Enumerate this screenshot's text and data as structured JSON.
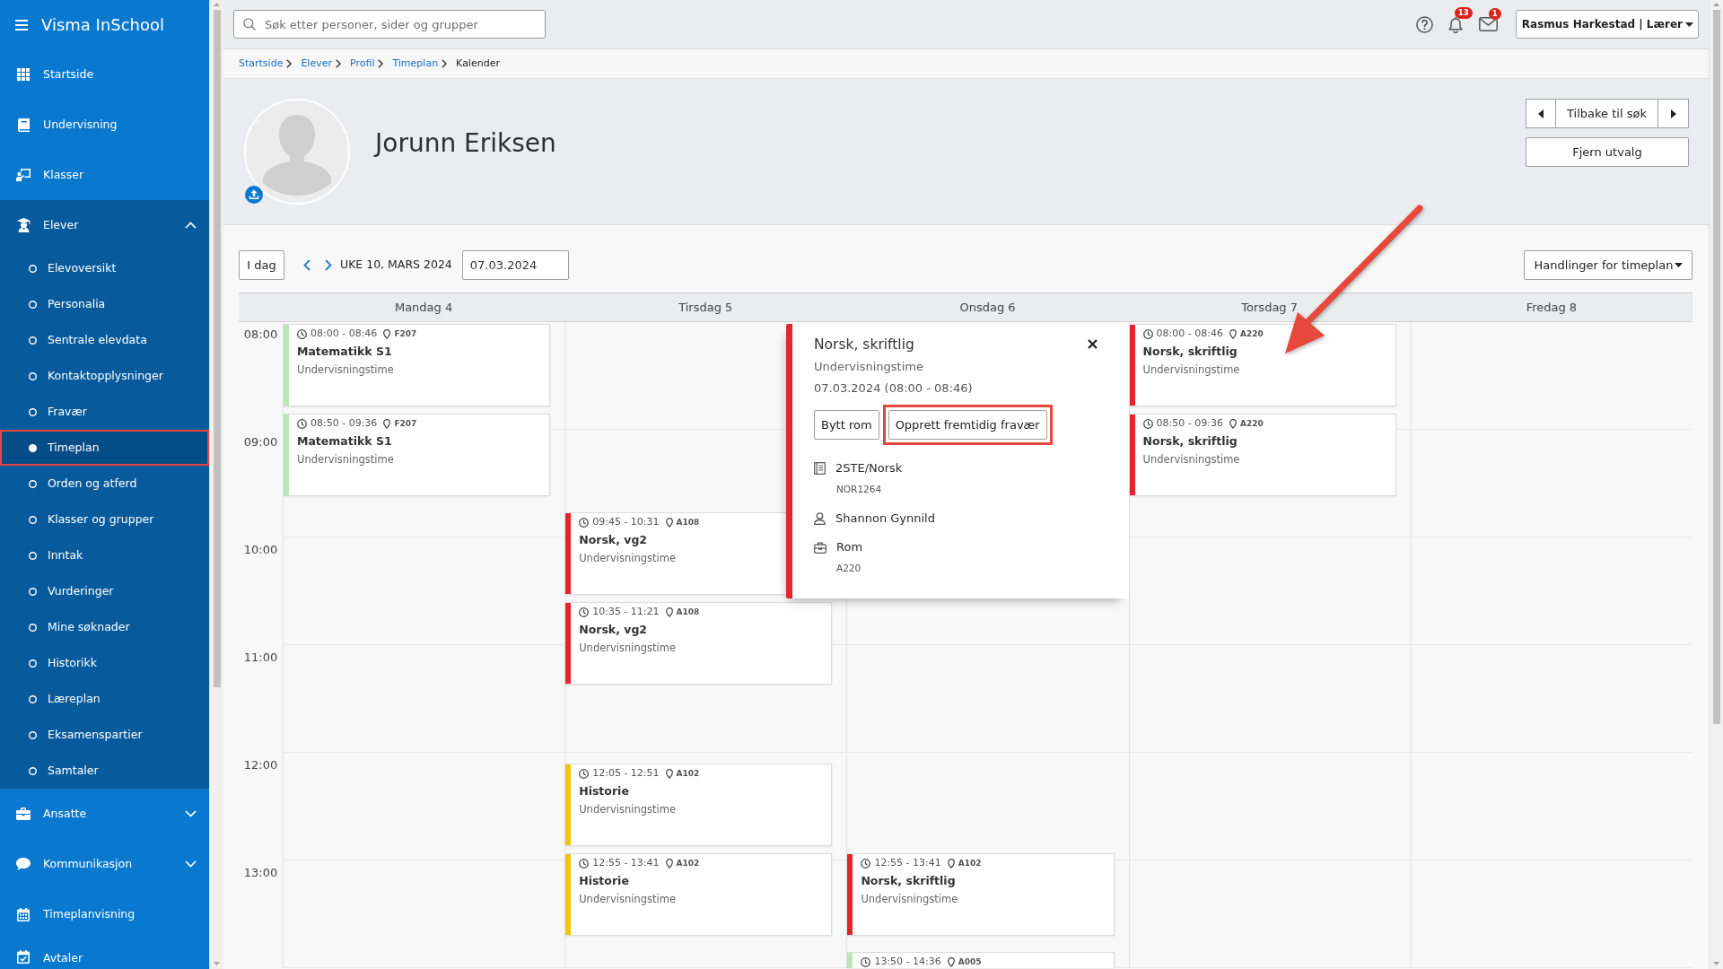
{
  "sidebar": {
    "title": "Visma InSchool",
    "items": [
      {
        "kind": "link",
        "label": "Startside"
      },
      {
        "kind": "link",
        "label": "Undervisning"
      },
      {
        "kind": "link",
        "label": "Klasser"
      },
      {
        "kind": "group",
        "label": "Elever",
        "expanded": true,
        "children": [
          {
            "label": "Elevoversikt",
            "selected": false,
            "highlighted": false
          },
          {
            "label": "Personalia",
            "selected": false,
            "highlighted": false
          },
          {
            "label": "Sentrale elevdata",
            "selected": false,
            "highlighted": false
          },
          {
            "label": "Kontaktopplysninger",
            "selected": false,
            "highlighted": false
          },
          {
            "label": "Fravær",
            "selected": false,
            "highlighted": false
          },
          {
            "label": "Timeplan",
            "selected": true,
            "highlighted": true
          },
          {
            "label": "Orden og atferd",
            "selected": false,
            "highlighted": false
          },
          {
            "label": "Klasser og grupper",
            "selected": false,
            "highlighted": false
          },
          {
            "label": "Inntak",
            "selected": false,
            "highlighted": false
          },
          {
            "label": "Vurderinger",
            "selected": false,
            "highlighted": false
          },
          {
            "label": "Mine søknader",
            "selected": false,
            "highlighted": false
          },
          {
            "label": "Historikk",
            "selected": false,
            "highlighted": false
          },
          {
            "label": "Læreplan",
            "selected": false,
            "highlighted": false
          },
          {
            "label": "Eksamenspartier",
            "selected": false,
            "highlighted": false
          },
          {
            "label": "Samtaler",
            "selected": false,
            "highlighted": false
          }
        ]
      },
      {
        "kind": "group",
        "label": "Ansatte",
        "expanded": false
      },
      {
        "kind": "group",
        "label": "Kommunikasjon",
        "expanded": false
      },
      {
        "kind": "link",
        "label": "Timeplanvisning"
      },
      {
        "kind": "link",
        "label": "Avtaler"
      }
    ]
  },
  "top_bar": {
    "search": {
      "placeholder": "Søk etter personer, sider og grupper"
    },
    "notifications": {
      "count": "13"
    },
    "messages": {
      "count": "1"
    },
    "user_menu": {
      "label": "Rasmus Harkestad | Lærer"
    }
  },
  "breadcrumbs": [
    {
      "label": "Startside",
      "current": false
    },
    {
      "label": "Elever",
      "current": false
    },
    {
      "label": "Profil",
      "current": false
    },
    {
      "label": "Timeplan",
      "current": false
    },
    {
      "label": "Kalender",
      "current": true
    }
  ],
  "profile": {
    "name": "Jorunn Eriksen",
    "back_button": "Tilbake til søk",
    "clear_button": "Fjern utvalg"
  },
  "calendar": {
    "today_button": "I dag",
    "week_label": "UKE 10, MARS 2024",
    "date": {
      "value": "07.03.2024"
    },
    "actions_button": "Handlinger for timeplan",
    "hours": [
      "08:00",
      "09:00",
      "10:00",
      "11:00",
      "12:00",
      "13:00"
    ],
    "days": [
      {
        "label": "Mandag 4",
        "events": [
          {
            "time": "08:00 - 08:46",
            "room": "F207",
            "title": "Matematikk S1",
            "type": "Undervisningstime",
            "color": "#b9e5b9"
          },
          {
            "time": "08:50 - 09:36",
            "room": "F207",
            "title": "Matematikk S1",
            "type": "Undervisningstime",
            "color": "#b9e5b9"
          }
        ]
      },
      {
        "label": "Tirsdag 5",
        "events": [
          {
            "time": "09:45 - 10:31",
            "room": "A108",
            "title": "Norsk, vg2",
            "type": "Undervisningstime",
            "color": "#e3262b"
          },
          {
            "time": "10:35 - 11:21",
            "room": "A108",
            "title": "Norsk, vg2",
            "type": "Undervisningstime",
            "color": "#e3262b"
          },
          {
            "time": "12:05 - 12:51",
            "room": "A102",
            "title": "Historie",
            "type": "Undervisningstime",
            "color": "#f1c40f"
          },
          {
            "time": "12:55 - 13:41",
            "room": "A102",
            "title": "Historie",
            "type": "Undervisningstime",
            "color": "#f1c40f"
          }
        ]
      },
      {
        "label": "Onsdag 6",
        "events": [
          {
            "time": "12:55 - 13:41",
            "room": "A102",
            "title": "Norsk, skriftlig",
            "type": "Undervisningstime",
            "color": "#e3262b"
          },
          {
            "time": "13:50 - 14:36",
            "room": "A005",
            "color": "#b9e5b9"
          }
        ]
      },
      {
        "label": "Torsdag 7",
        "events": [
          {
            "time": "08:00 - 08:46",
            "room": "A220",
            "title": "Norsk, skriftlig",
            "type": "Undervisningstime",
            "color": "#e3262b"
          },
          {
            "time": "08:50 - 09:36",
            "room": "A220",
            "title": "Norsk, skriftlig",
            "type": "Undervisningstime",
            "color": "#e3262b"
          }
        ]
      },
      {
        "label": "Fredag 8"
      }
    ],
    "popup": {
      "title": "Norsk, skriftlig",
      "type": "Undervisningstime",
      "when": "07.03.2024 (08:00 - 08:46)",
      "color": "#e3262b",
      "buttons": [
        {
          "label": "Bytt rom",
          "highlighted": false
        },
        {
          "label": "Opprett fremtidig fravær",
          "highlighted": true
        }
      ],
      "details": [
        {
          "label": "2STE/Norsk",
          "sub": "NOR1264"
        },
        {
          "label": "Shannon Gynnild"
        },
        {
          "label": "Rom",
          "sub": "A220"
        }
      ]
    }
  }
}
